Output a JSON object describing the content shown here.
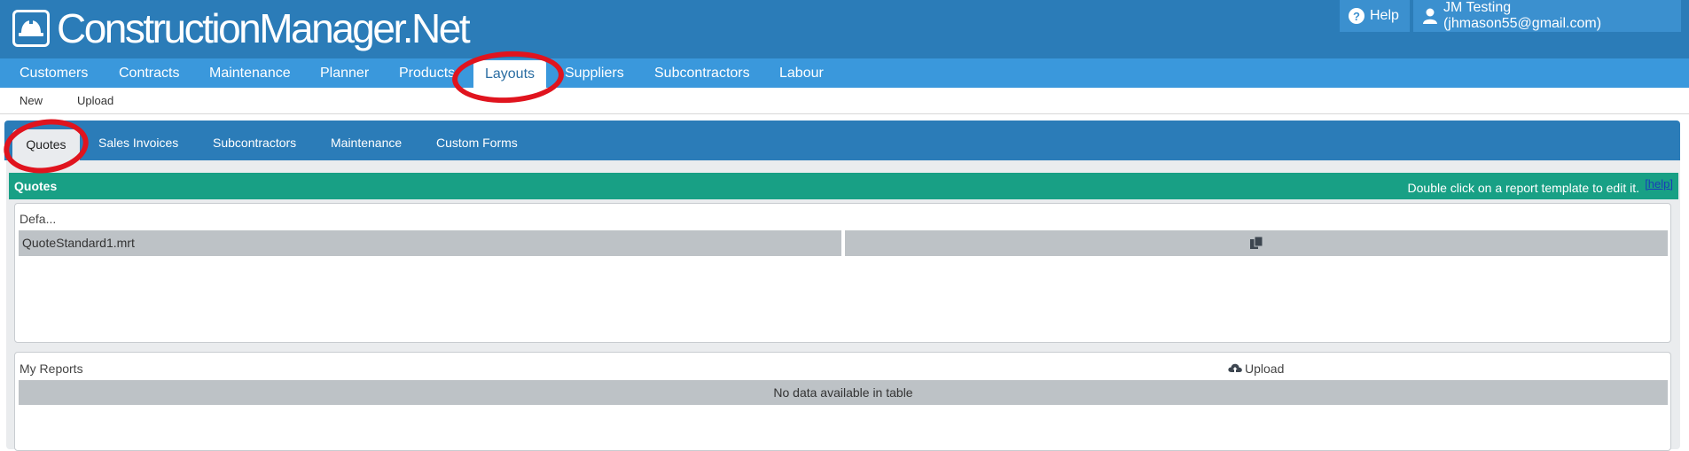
{
  "app": {
    "logo_text": "ConstructionManager.Net",
    "help_label": "Help",
    "user_label": "JM Testing (jhmason55@gmail.com)"
  },
  "nav": {
    "items": [
      "Customers",
      "Contracts",
      "Maintenance",
      "Planner",
      "Products",
      "Layouts",
      "Suppliers",
      "Subcontractors",
      "Labour"
    ],
    "active": "Layouts"
  },
  "subnav": {
    "new_label": "New",
    "upload_label": "Upload"
  },
  "tabs": {
    "items": [
      "Quotes",
      "Sales Invoices",
      "Subcontractors",
      "Maintenance",
      "Custom Forms"
    ],
    "active": "Quotes"
  },
  "section": {
    "title": "Quotes",
    "note": "Double click on a report template to edit it.",
    "help_link": "[help]"
  },
  "default_box": {
    "label": "Defa...",
    "rows": [
      {
        "name": "QuoteStandard1.mrt",
        "action_icon": "copy-icon"
      }
    ]
  },
  "my_reports": {
    "label": "My Reports",
    "upload_label": "Upload",
    "empty_text": "No data available in table"
  },
  "colors": {
    "header": "#2b7cb8",
    "nav": "#3a98dc",
    "section_header": "#18a085",
    "row": "#bdc2c6",
    "annotation": "#e0141e"
  }
}
